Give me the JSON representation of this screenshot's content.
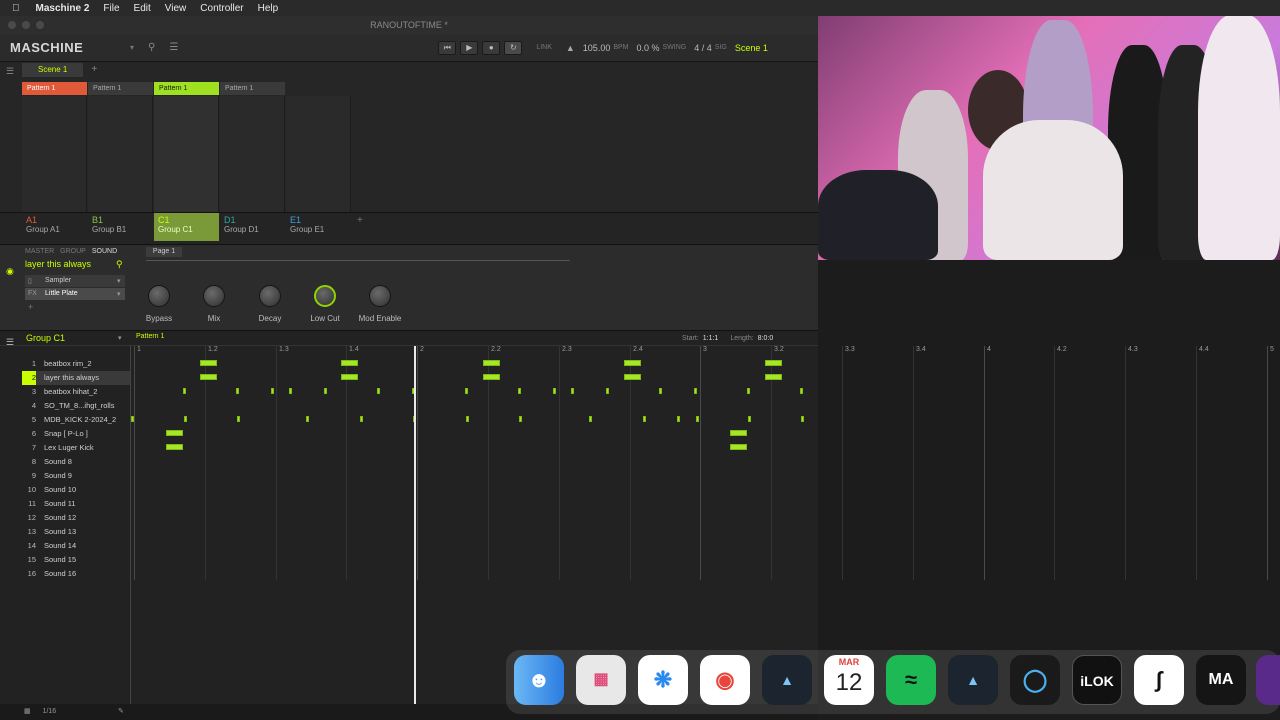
{
  "menubar": {
    "apple": "",
    "app_name": "Maschine 2",
    "items": [
      "File",
      "Edit",
      "View",
      "Controller",
      "Help"
    ]
  },
  "window": {
    "title": "RANOUTOFTIME *"
  },
  "toolbar": {
    "logo": "MASCHINE",
    "link": "LINK",
    "bpm_value": "105.00",
    "bpm_label": "BPM",
    "swing_value": "0.0 %",
    "swing_label": "SWING",
    "sig_value": "4 / 4",
    "sig_label": "SIG",
    "scene_name": "Scene 1"
  },
  "arranger": {
    "scene_tab": "Scene 1",
    "add_scene": "+",
    "patterns": [
      {
        "label": "Pattern 1",
        "color": "#e05a3a"
      },
      {
        "label": "Pattern 1",
        "color": "#3a3a3a"
      },
      {
        "label": "Pattern 1",
        "color": "#9fe020"
      },
      {
        "label": "Pattern 1",
        "color": "#3a3a3a"
      }
    ]
  },
  "groups": [
    {
      "letter": "A1",
      "name": "Group A1",
      "color": "#e05a3a"
    },
    {
      "letter": "B1",
      "name": "Group B1",
      "color": "#8fbf4a"
    },
    {
      "letter": "C1",
      "name": "Group C1",
      "color": "#c8ff00"
    },
    {
      "letter": "D1",
      "name": "Group D1",
      "color": "#2fa7a0"
    },
    {
      "letter": "E1",
      "name": "Group E1",
      "color": "#3aa0e0"
    }
  ],
  "add_group": "+",
  "sound_panel": {
    "tabs": [
      "MASTER",
      "GROUP",
      "SOUND"
    ],
    "page_label": "Page 1",
    "sound_name": "layer this always",
    "plugins": [
      "Sampler",
      "Little Plate"
    ],
    "knobs": [
      "Bypass",
      "Mix",
      "Decay",
      "Low Cut",
      "Mod Enable"
    ]
  },
  "pattern_editor": {
    "group_name": "Group C1",
    "pattern_name": "Pattern 1",
    "start_label": "Start:",
    "start_value": "1:1:1",
    "length_label": "Length:",
    "length_value": "8:0:0",
    "beat_labels": [
      "1",
      "1.2",
      "1.3",
      "1.4",
      "2",
      "2.2",
      "2.3",
      "2.4",
      "3",
      "3.2",
      "3.3",
      "3.4",
      "4",
      "4.2",
      "4.3",
      "4.4",
      "5"
    ],
    "sounds": [
      "beatbox rim_2",
      "layer this always",
      "beatbox hihat_2",
      "SO_TM_8...ihgt_rolls",
      "MDB_KICK 2-2024_2",
      "Snap [ P-Lo ]",
      "Lex Luger Kick",
      "Sound 8",
      "Sound 9",
      "Sound 10",
      "Sound 11",
      "Sound 12",
      "Sound 13",
      "Sound 14",
      "Sound 15",
      "Sound 16"
    ]
  },
  "statusbar": {
    "grid": "1/16"
  },
  "dock": {
    "calendar_month": "MAR",
    "calendar_day": "12",
    "ilok": "iLOK",
    "ma": "MA"
  }
}
